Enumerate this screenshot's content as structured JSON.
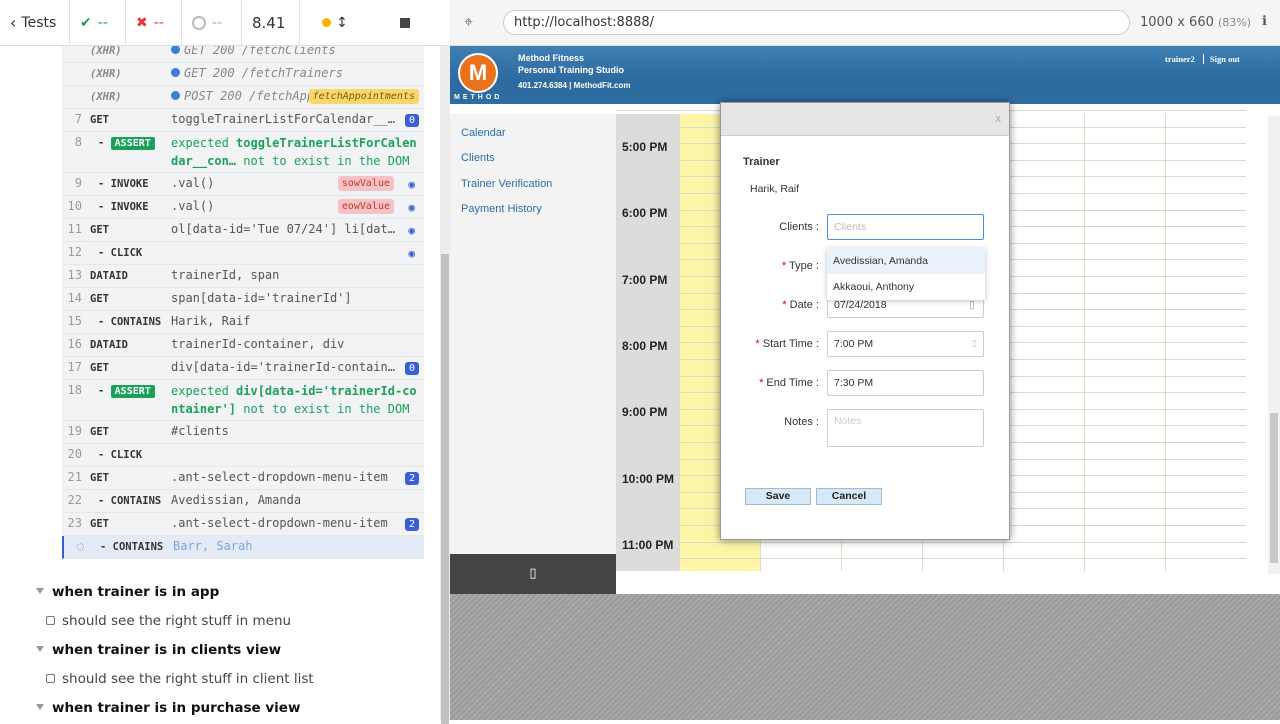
{
  "topbar": {
    "tests_label": "Tests",
    "passed": "--",
    "failed": "--",
    "pending": "--",
    "duration": "8.41"
  },
  "url": {
    "address": "http://localhost:8888/",
    "viewport": "1000 x 660",
    "scale": "(83%)"
  },
  "commands": [
    {
      "num": "",
      "name": "(XHR)",
      "msg": "GET 200 /fetchClients",
      "type": "xhr"
    },
    {
      "num": "",
      "name": "(XHR)",
      "msg": "GET 200 /fetchTrainers",
      "type": "xhr"
    },
    {
      "num": "",
      "name": "(XHR)",
      "msg": "POST 200 /fetchApp…",
      "type": "xhr",
      "alias": "fetchAppointments"
    },
    {
      "num": "7",
      "name": "GET",
      "msg": "toggleTrainerListForCalendar__…",
      "badge": "0"
    },
    {
      "num": "8",
      "name": "- ASSERT",
      "msg1": "expected",
      "msg2": "toggleTrainerListForCalendar__con…",
      "msg3": "not to exist in the DOM",
      "type": "assert"
    },
    {
      "num": "9",
      "name": "- INVOKE",
      "msg": ".val()",
      "alias": "sowValue"
    },
    {
      "num": "10",
      "name": "- INVOKE",
      "msg": ".val()",
      "alias": "eowValue"
    },
    {
      "num": "11",
      "name": "GET",
      "msg": "ol[data-id='Tue 07/24'] li[dat…"
    },
    {
      "num": "12",
      "name": "- CLICK",
      "msg": ""
    },
    {
      "num": "13",
      "name": "DATAID",
      "msg": "trainerId, span"
    },
    {
      "num": "14",
      "name": "GET",
      "msg": "span[data-id='trainerId']"
    },
    {
      "num": "15",
      "name": "- CONTAINS",
      "msg": "Harik, Raif"
    },
    {
      "num": "16",
      "name": "DATAID",
      "msg": "trainerId-container, div"
    },
    {
      "num": "17",
      "name": "GET",
      "msg": "div[data-id='trainerId-contain…",
      "badge": "0"
    },
    {
      "num": "18",
      "name": "- ASSERT",
      "msg1": "expected",
      "msg2": "div[data-id='trainerId-container']",
      "msg3": "not to exist in the DOM",
      "type": "assert"
    },
    {
      "num": "19",
      "name": "GET",
      "msg": "#clients"
    },
    {
      "num": "20",
      "name": "- CLICK",
      "msg": ""
    },
    {
      "num": "21",
      "name": "GET",
      "msg": ".ant-select-dropdown-menu-item",
      "badge": "2"
    },
    {
      "num": "22",
      "name": "- CONTAINS",
      "msg": "Avedissian, Amanda"
    },
    {
      "num": "23",
      "name": "GET",
      "msg": ".ant-select-dropdown-menu-item",
      "badge": "2"
    },
    {
      "num": "",
      "name": "- CONTAINS",
      "msg": "Barr, Sarah",
      "type": "active"
    }
  ],
  "suites": [
    {
      "title": "when trainer is in app",
      "test": "should see the right stuff in menu"
    },
    {
      "title": "when trainer is in clients view",
      "test": "should see the right stuff in client list"
    },
    {
      "title": "when trainer is in purchase view"
    }
  ],
  "app": {
    "brand_line1": "Method Fitness",
    "brand_line2": "Personal Training Studio",
    "brand_line3": "401.274.6384 | MethodFit.com",
    "logo_word": "METHOD",
    "user": "trainer2",
    "signout": "Sign out",
    "nav": [
      "Calendar",
      "Clients",
      "Trainer Verification",
      "Payment History"
    ],
    "times": [
      "5:00 PM",
      "6:00 PM",
      "7:00 PM",
      "8:00 PM",
      "9:00 PM",
      "10:00 PM",
      "11:00 PM"
    ]
  },
  "modal": {
    "close": "x",
    "trainer_heading": "Trainer",
    "trainer_name": "Harik, Raif",
    "clients_label": "Clients",
    "clients_placeholder": "Clients",
    "type_label": "Type",
    "date_label": "Date",
    "date_value": "07/24/2018",
    "start_label": "Start Time",
    "start_value": "7:00 PM",
    "end_label": "End Time",
    "end_value": "7:30 PM",
    "notes_label": "Notes",
    "notes_placeholder": "Notes",
    "save": "Save",
    "cancel": "Cancel",
    "dropdown": [
      "Avedissian, Amanda",
      "Akkaoui, Anthony"
    ]
  },
  "colors": {
    "pass": "#1aa15a",
    "fail": "#e03a3a",
    "link": "#2a6dab",
    "header": "#2d6a9f",
    "today_column": "#fdf5a6"
  }
}
